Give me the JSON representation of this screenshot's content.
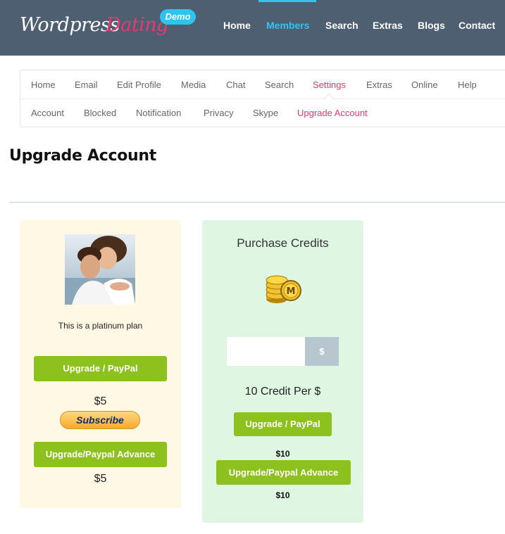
{
  "header": {
    "logo_word1": "Wordpress",
    "logo_word2": "Dating",
    "logo_badge": "Demo",
    "nav": [
      "Home",
      "Members",
      "Search",
      "Extras",
      "Blogs",
      "Contact"
    ],
    "active_nav": "Members"
  },
  "subnav": {
    "row1": [
      "Home",
      "Email",
      "Edit Profile",
      "Media",
      "Chat",
      "Search",
      "Settings",
      "Extras",
      "Online",
      "Help"
    ],
    "row2": [
      "Account",
      "Blocked",
      "Notification",
      "Privacy",
      "Skype",
      "Upgrade Account"
    ],
    "active_row1": "Settings",
    "active_row2": "Upgrade Account"
  },
  "page": {
    "title": "Upgrade Account"
  },
  "plan": {
    "description": "This is a platinum plan",
    "paypal_label": "Upgrade / PayPal",
    "price1": "$5",
    "subscribe_label": "Subscribe",
    "advance_label": "Upgrade/Paypal Advance",
    "price2": "$5"
  },
  "credits": {
    "title": "Purchase Credits",
    "input_value": "",
    "currency_symbol": "$",
    "rate": "10 Credit Per $",
    "paypal_label": "Upgrade / PayPal",
    "price1": "$10",
    "advance_label": "Upgrade/Paypal Advance",
    "price2": "$10"
  },
  "colors": {
    "header_bg": "#4f5f72",
    "accent_blue": "#39c0f0",
    "accent_pink": "#e8396f",
    "button_green": "#8cc11e",
    "plan_bg": "#fef8e4",
    "credit_bg": "#dff7e2"
  }
}
